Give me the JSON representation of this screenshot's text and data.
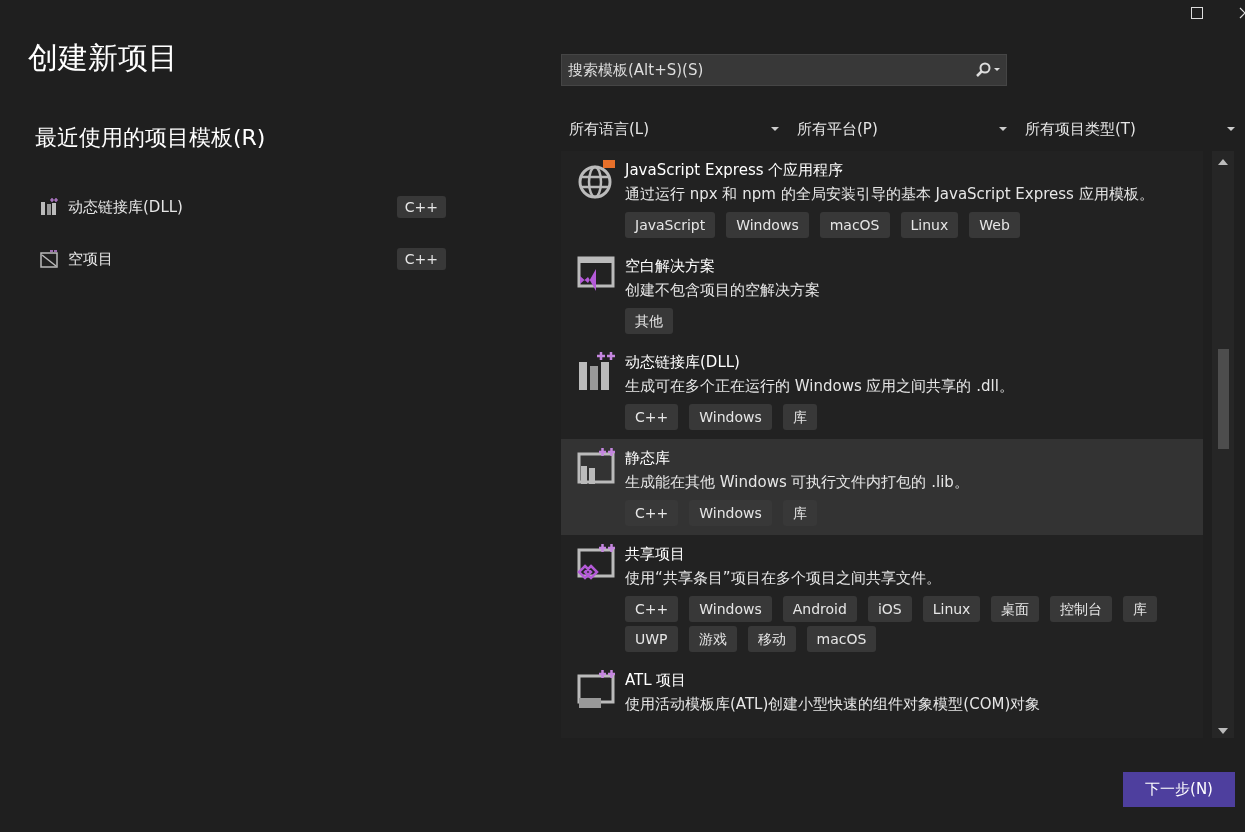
{
  "window": {
    "title": "创建新项目"
  },
  "recent": {
    "heading": "最近使用的项目模板(R)",
    "items": [
      {
        "name": "动态链接库(DLL)",
        "kind": "dll",
        "tag": "C++"
      },
      {
        "name": "空项目",
        "kind": "empty",
        "tag": "C++"
      }
    ]
  },
  "search": {
    "placeholder": "搜索模板(Alt+S)(S)"
  },
  "filters": [
    {
      "label": "所有语言(L)"
    },
    {
      "label": "所有平台(P)"
    },
    {
      "label": "所有项目类型(T)"
    }
  ],
  "templates": [
    {
      "kind": "globe",
      "title": "JavaScript Express 个应用程序",
      "description": "通过运行 npx 和 npm 的全局安装引导的基本 JavaScript Express 应用模板。",
      "selected": false,
      "tags": [
        "JavaScript",
        "Windows",
        "macOS",
        "Linux",
        "Web"
      ]
    },
    {
      "kind": "solution",
      "title": "空白解决方案",
      "description": "创建不包含项目的空解决方案",
      "selected": false,
      "tags": [
        "其他"
      ]
    },
    {
      "kind": "dll",
      "title": "动态链接库(DLL)",
      "description": "生成可在多个正在运行的 Windows 应用之间共享的 .dll。",
      "selected": false,
      "tags": [
        "C++",
        "Windows",
        "库"
      ]
    },
    {
      "kind": "lib",
      "title": "静态库",
      "description": "生成能在其他 Windows 可执行文件内打包的 .lib。",
      "selected": true,
      "tags": [
        "C++",
        "Windows",
        "库"
      ]
    },
    {
      "kind": "shared",
      "title": "共享项目",
      "description": "使用“共享条目”项目在多个项目之间共享文件。",
      "selected": false,
      "tags": [
        "C++",
        "Windows",
        "Android",
        "iOS",
        "Linux",
        "桌面",
        "控制台",
        "库",
        "UWP",
        "游戏",
        "移动",
        "macOS"
      ]
    },
    {
      "kind": "atl",
      "title": "ATL 项目",
      "description": "使用活动模板库(ATL)创建小型快速的组件对象模型(COM)对象",
      "selected": false
    }
  ],
  "next_button": {
    "label": "下一步(N)"
  }
}
